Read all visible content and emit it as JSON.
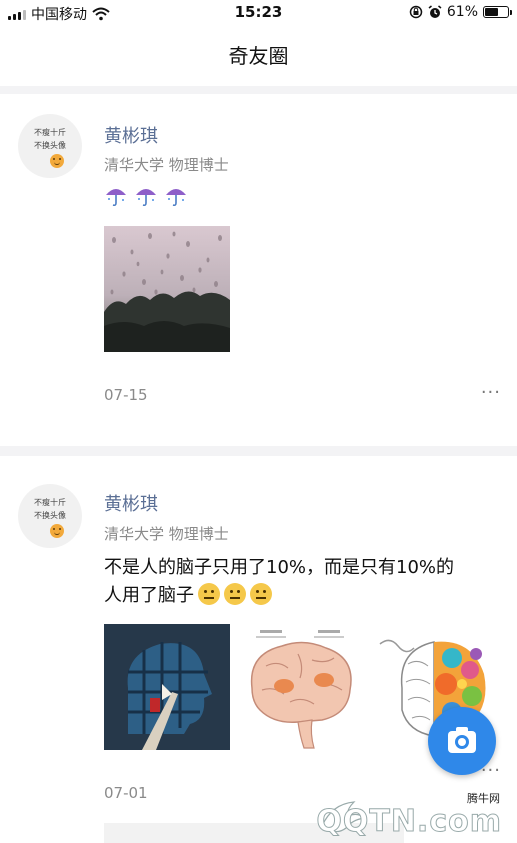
{
  "status_bar": {
    "carrier": "中国移动",
    "time": "15:23",
    "battery_text": "61%",
    "battery_level": 0.61
  },
  "navbar": {
    "title": "奇友圈"
  },
  "posts": [
    {
      "avatar_lines": [
        "不瘦十斤",
        "不换头像"
      ],
      "name": "黄彬琪",
      "meta": "清华大学 物理博士",
      "date": "07-15",
      "more": "···"
    },
    {
      "avatar_lines": [
        "不瘦十斤",
        "不换头像"
      ],
      "name": "黄彬琪",
      "meta": "清华大学 物理博士",
      "text_line1": "不是人的脑子只用了10%，而是只有10%的",
      "text_line2": "人用了脑子",
      "date": "07-01",
      "more": "···"
    }
  ],
  "watermark": {
    "small": "腾牛网",
    "big": "QQTN.com"
  },
  "icons": [
    "signal-icon",
    "wifi-icon",
    "lock-rotation-icon",
    "alarm-icon",
    "battery-icon",
    "umbrella-icon",
    "neutral-face-icon",
    "camera-icon",
    "more-icon"
  ],
  "colors": {
    "name": "#5b6f95",
    "fab": "#2f88e9",
    "meta": "#8a8a8a"
  }
}
